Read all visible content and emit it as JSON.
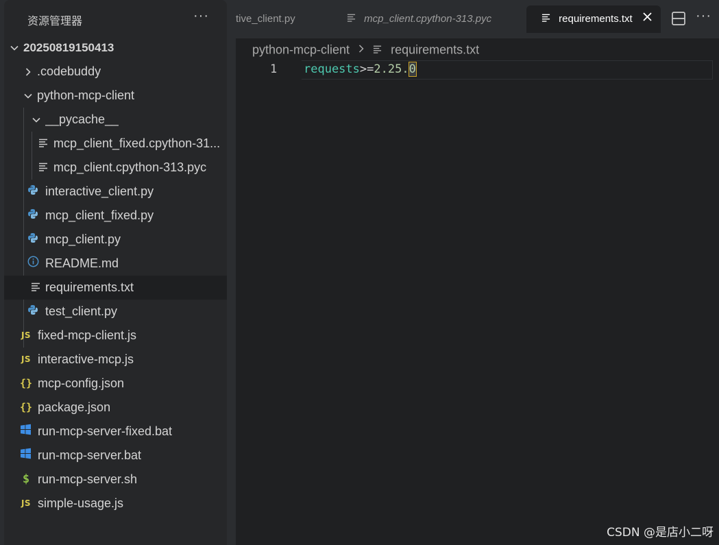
{
  "sidebar": {
    "title": "资源管理器",
    "more": "···",
    "root": "20250819150413",
    "items": [
      {
        "label": ".codebuddy"
      },
      {
        "label": "python-mcp-client"
      },
      {
        "label": "__pycache__"
      },
      {
        "label": "mcp_client_fixed.cpython-31..."
      },
      {
        "label": "mcp_client.cpython-313.pyc"
      },
      {
        "label": "interactive_client.py"
      },
      {
        "label": "mcp_client_fixed.py"
      },
      {
        "label": "mcp_client.py"
      },
      {
        "label": "README.md"
      },
      {
        "label": "requirements.txt"
      },
      {
        "label": "test_client.py"
      },
      {
        "label": "fixed-mcp-client.js"
      },
      {
        "label": "interactive-mcp.js"
      },
      {
        "label": "mcp-config.json"
      },
      {
        "label": "package.json"
      },
      {
        "label": "run-mcp-server-fixed.bat"
      },
      {
        "label": "run-mcp-server.bat"
      },
      {
        "label": "run-mcp-server.sh"
      },
      {
        "label": "simple-usage.js"
      }
    ],
    "glyphs": {
      "js": "JS",
      "json": "{}",
      "sh": "$"
    }
  },
  "tabs": [
    {
      "label": "tive_client.py"
    },
    {
      "label": "mcp_client.cpython-313.pyc"
    },
    {
      "label": "requirements.txt"
    }
  ],
  "toolbar": {
    "more": "···"
  },
  "breadcrumb": {
    "folder": "python-mcp-client",
    "file": "requirements.txt"
  },
  "editor": {
    "line_number": "1",
    "package": "requests",
    "operator": ">=",
    "version_start": "2.25.",
    "version_end": "0"
  },
  "watermark": "CSDN @是店小二呀",
  "colors": {
    "python_icon": "#4a90c8",
    "js_icon": "#d8c94f",
    "windows_icon": "#3d8ee6",
    "shell_icon": "#8dc149",
    "token_name": "#4ec9b0",
    "token_version": "#b5cea8"
  }
}
